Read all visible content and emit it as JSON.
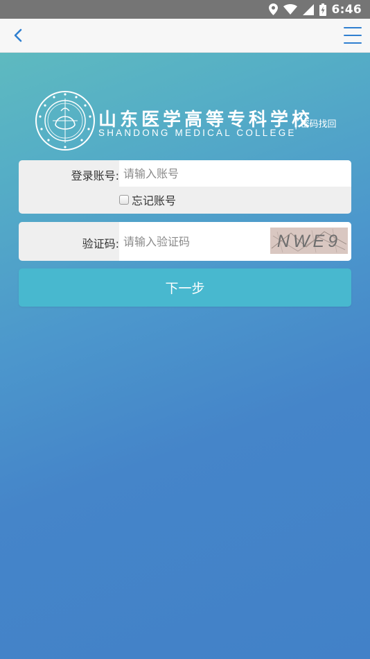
{
  "status_bar": {
    "time": "6:46",
    "icons": [
      "location-icon",
      "wifi-icon",
      "signal-icon",
      "battery-charging-icon"
    ]
  },
  "nav": {
    "back_icon": "chevron-left-icon",
    "menu_icon": "hamburger-menu-icon"
  },
  "logo": {
    "name_cn": "山东医学高等专科学校",
    "name_en": "SHANDONG MEDICAL COLLEGE",
    "subtitle": "| 密码找回"
  },
  "form": {
    "account_label": "登录账号:",
    "account_placeholder": "请输入账号",
    "account_value": "",
    "remember_label": "忘记账号",
    "remember_checked": false,
    "captcha_label": "验证码:",
    "captcha_placeholder": "请输入验证码",
    "captcha_value": "",
    "captcha_text": "NWE9",
    "next_label": "下一步"
  },
  "colors": {
    "accent_blue": "#2f7fd0",
    "button": "#48b8cf",
    "status_bar": "#757575",
    "gradient_top": "#62bfbd",
    "gradient_bottom": "#4281c8"
  }
}
